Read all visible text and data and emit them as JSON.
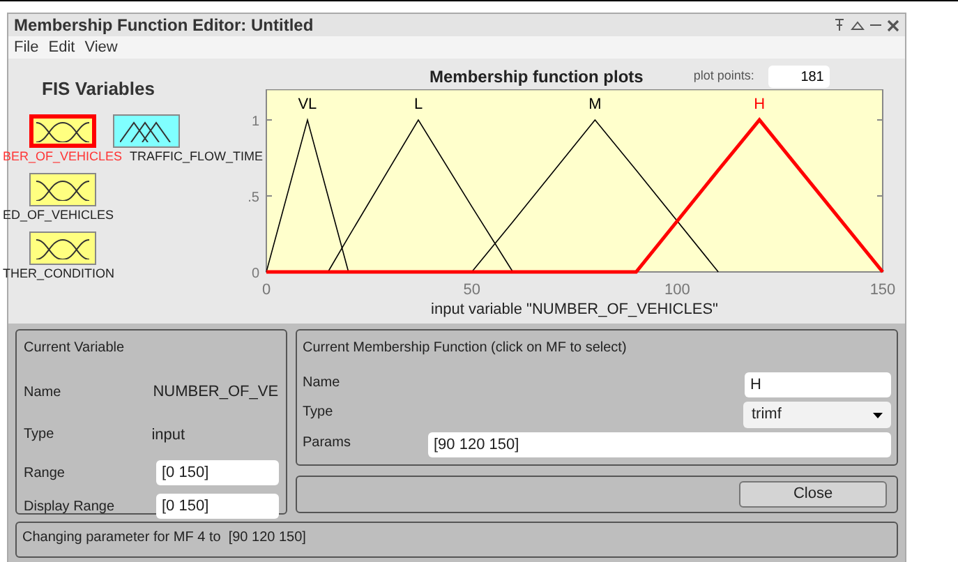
{
  "window": {
    "title": "Membership Function Editor: Untitled"
  },
  "menu": [
    "File",
    "Edit",
    "View"
  ],
  "fis_variables": {
    "title": "FIS Variables",
    "items": [
      {
        "label": "BER_OF_VEHICLES",
        "kind": "input",
        "selected": true
      },
      {
        "label": "TRAFFIC_FLOW_TIME",
        "kind": "output",
        "selected": false
      },
      {
        "label": "ED_OF_VEHICLES",
        "kind": "input",
        "selected": false
      },
      {
        "label": "THER_CONDITION",
        "kind": "input",
        "selected": false
      }
    ]
  },
  "plot": {
    "plot_points_label": "plot points:",
    "plot_points": "181",
    "chart_data": {
      "type": "line",
      "title": "Membership function plots",
      "xlabel": "input variable \"NUMBER_OF_VEHICLES\"",
      "x": [
        0,
        10,
        15,
        20,
        37,
        50,
        60,
        80,
        90,
        110,
        120,
        150
      ],
      "series": [
        {
          "name": "VL",
          "color": "#000000",
          "values": [
            0,
            1,
            0.5,
            0,
            null,
            null,
            null,
            null,
            null,
            null,
            null,
            null
          ]
        },
        {
          "name": "L",
          "color": "#000000",
          "values": [
            null,
            null,
            0,
            0.23,
            1,
            0.43,
            0,
            null,
            null,
            null,
            null,
            null
          ]
        },
        {
          "name": "M",
          "color": "#000000",
          "values": [
            null,
            null,
            null,
            null,
            null,
            0,
            0.33,
            1,
            0.67,
            0,
            null,
            null
          ]
        },
        {
          "name": "H",
          "color": "#ff0000",
          "values": [
            0,
            0,
            0,
            0,
            0,
            0,
            0,
            0,
            0,
            0.67,
            1,
            0
          ]
        }
      ],
      "xlim": [
        0,
        150
      ],
      "ylim": [
        0,
        1.2
      ],
      "xticks": [
        0,
        50,
        100,
        150
      ],
      "yticks": [
        0,
        {
          "value": 0.5,
          "label": ".5"
        },
        1
      ]
    }
  },
  "current_variable": {
    "title": "Current Variable",
    "name_label": "Name",
    "name": "NUMBER_OF_VE",
    "type_label": "Type",
    "type": "input",
    "range_label": "Range",
    "range": "[0 150]",
    "display_range_label": "Display Range",
    "display_range": "[0 150]"
  },
  "current_mf": {
    "title": "Current Membership Function (click on MF to select)",
    "name_label": "Name",
    "name": "H",
    "type_label": "Type",
    "type": "trimf",
    "params_label": "Params",
    "params": "[90 120 150]"
  },
  "close_button": "Close",
  "status": "Changing parameter for MF 4 to  [90 120 150]"
}
